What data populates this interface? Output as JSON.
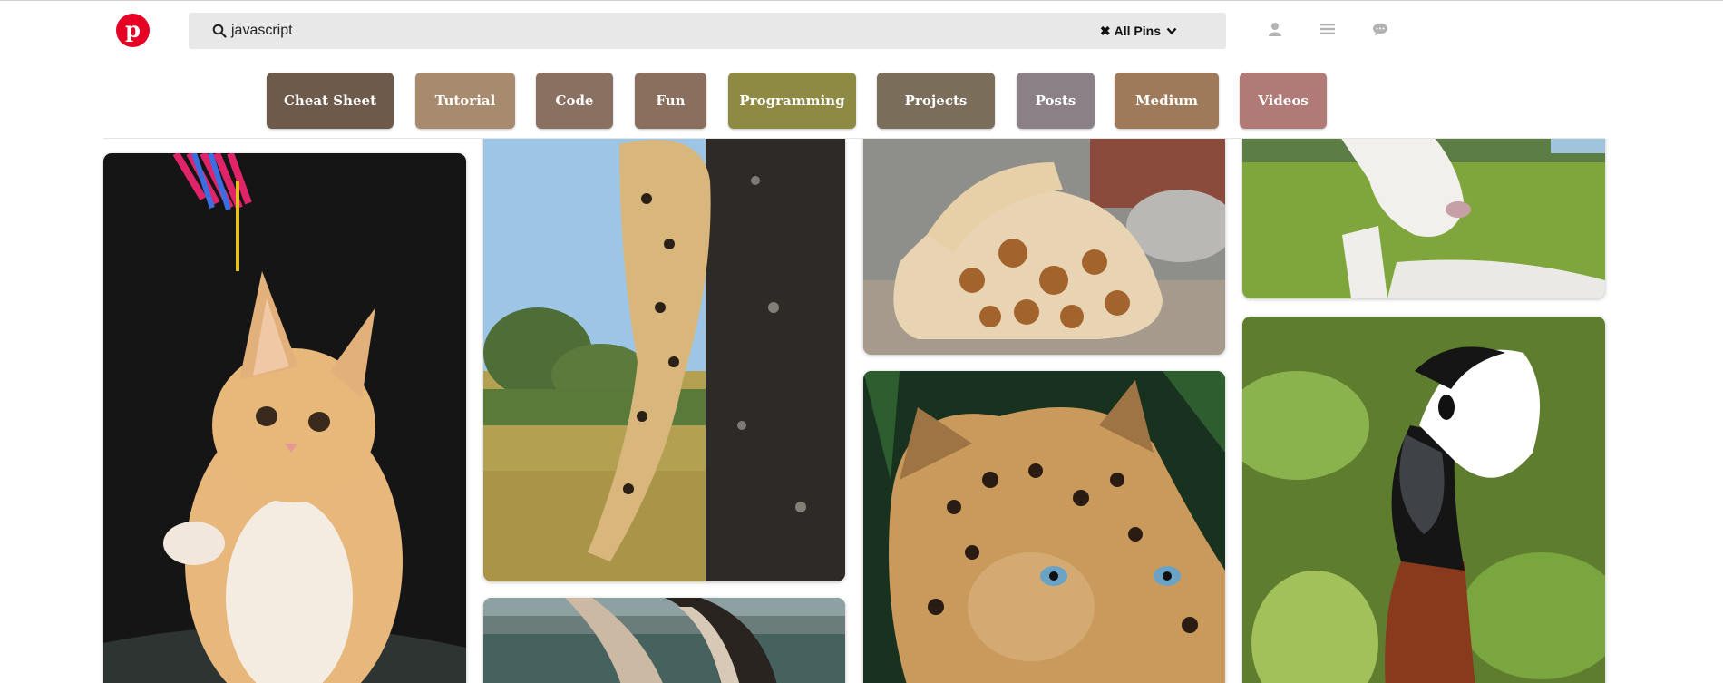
{
  "header": {
    "logo_letter": "p",
    "search": {
      "query": "javascript",
      "icon": "search-icon"
    },
    "scope": {
      "close_glyph": "✖",
      "label": "All Pins",
      "icon": "chevron-down-icon"
    },
    "nav_icons": [
      "user-icon",
      "menu-icon",
      "chat-icon"
    ]
  },
  "categories": [
    {
      "label": "Cheat Sheet",
      "color": "#6e5a4a"
    },
    {
      "label": "Tutorial",
      "color": "#a88a6e"
    },
    {
      "label": "Code",
      "color": "#8a7060"
    },
    {
      "label": "Fun",
      "color": "#8a6e5e"
    },
    {
      "label": "Programming",
      "color": "#8e8a44"
    },
    {
      "label": "Projects",
      "color": "#7a6e5a"
    },
    {
      "label": "Posts",
      "color": "#8a8086"
    },
    {
      "label": "Medium",
      "color": "#9e7a5a"
    },
    {
      "label": "Videos",
      "color": "#b07a76"
    }
  ],
  "pins": [
    {
      "subject": "kitten with feather toy"
    },
    {
      "subject": "leopard climbing tree"
    },
    {
      "subject": "giraffe resting"
    },
    {
      "subject": "white goat"
    },
    {
      "subject": "leopard face close-up"
    },
    {
      "subject": "zebra ear by water"
    },
    {
      "subject": "white-faced goose"
    }
  ]
}
